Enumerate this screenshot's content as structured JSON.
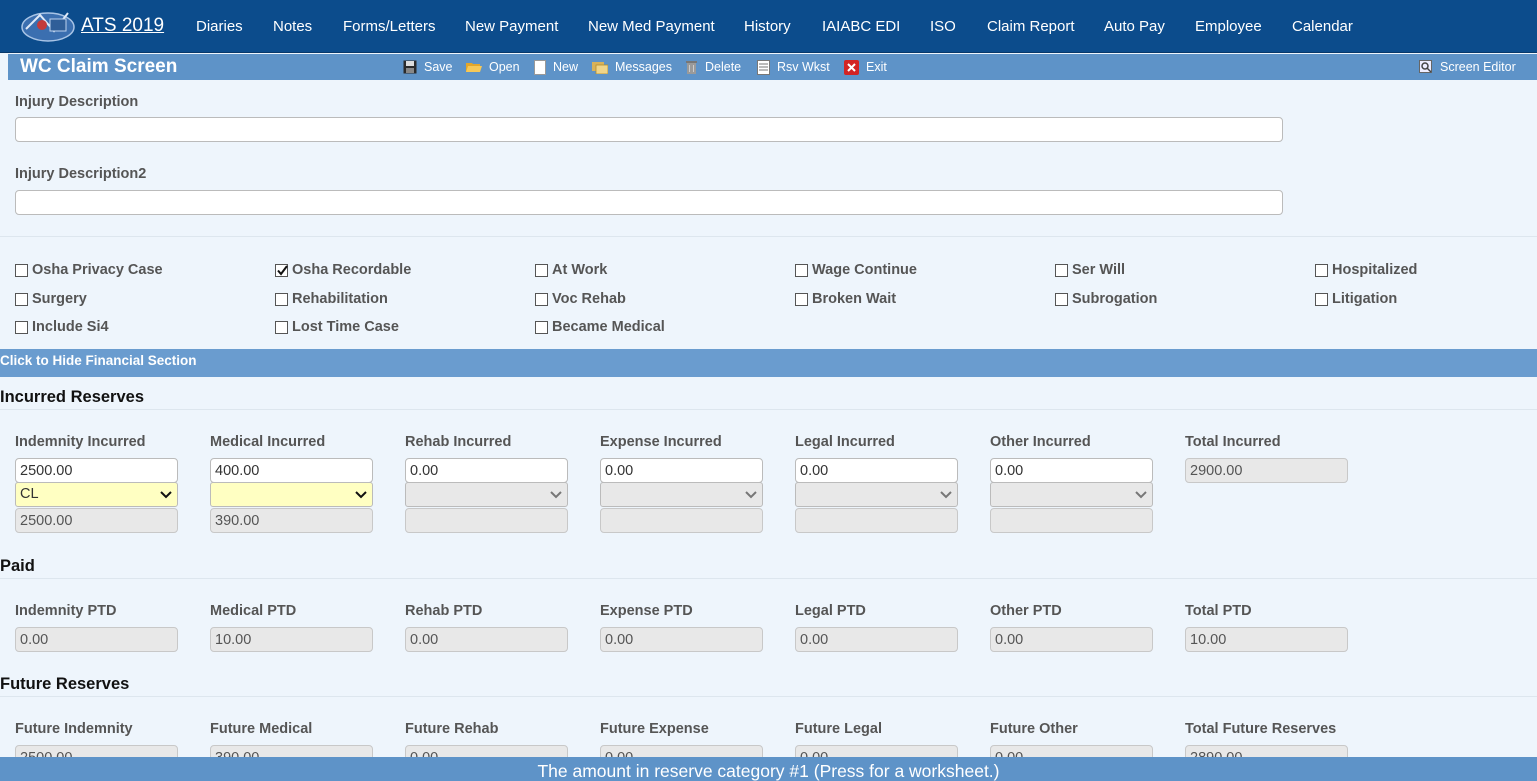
{
  "nav": {
    "app_title": "ATS 2019",
    "items": [
      "Diaries",
      "Notes",
      "Forms/Letters",
      "New Payment",
      "New Med Payment",
      "History",
      "IAIABC EDI",
      "ISO",
      "Claim Report",
      "Auto Pay",
      "Employee",
      "Calendar"
    ]
  },
  "toolbar": {
    "title": "WC Claim Screen",
    "save": "Save",
    "open": "Open",
    "new": "New",
    "messages": "Messages",
    "delete": "Delete",
    "rsv_wkst": "Rsv Wkst",
    "exit": "Exit",
    "screen_editor": "Screen Editor"
  },
  "injury": {
    "desc_label": "Injury Description",
    "desc_value": "",
    "desc2_label": "Injury Description2",
    "desc2_value": ""
  },
  "checkboxes": [
    {
      "label": "Osha Privacy Case",
      "checked": false
    },
    {
      "label": "Osha Recordable",
      "checked": true
    },
    {
      "label": "At Work",
      "checked": false
    },
    {
      "label": "Wage Continue",
      "checked": false
    },
    {
      "label": "Ser Will",
      "checked": false
    },
    {
      "label": "Hospitalized",
      "checked": false
    },
    {
      "label": "Surgery",
      "checked": false
    },
    {
      "label": "Rehabilitation",
      "checked": false
    },
    {
      "label": "Voc Rehab",
      "checked": false
    },
    {
      "label": "Broken Wait",
      "checked": false
    },
    {
      "label": "Subrogation",
      "checked": false
    },
    {
      "label": "Litigation",
      "checked": false
    },
    {
      "label": "Include Si4",
      "checked": false
    },
    {
      "label": "Lost Time Case",
      "checked": false
    },
    {
      "label": "Became Medical",
      "checked": false
    }
  ],
  "financial_toggle": "Click to Hide Financial Section",
  "incurred": {
    "heading": "Incurred Reserves",
    "columns": [
      {
        "label": "Indemnity Incurred",
        "value": "2500.00",
        "select": "CL",
        "sub": "2500.00"
      },
      {
        "label": "Medical Incurred",
        "value": "400.00",
        "select": "",
        "sub": "390.00"
      },
      {
        "label": "Rehab Incurred",
        "value": "0.00",
        "select": "",
        "sub": ""
      },
      {
        "label": "Expense Incurred",
        "value": "0.00",
        "select": "",
        "sub": ""
      },
      {
        "label": "Legal Incurred",
        "value": "0.00",
        "select": "",
        "sub": ""
      },
      {
        "label": "Other Incurred",
        "value": "0.00",
        "select": "",
        "sub": ""
      }
    ],
    "total_label": "Total Incurred",
    "total_value": "2900.00"
  },
  "paid": {
    "heading": "Paid",
    "columns": [
      {
        "label": "Indemnity PTD",
        "value": "0.00"
      },
      {
        "label": "Medical PTD",
        "value": "10.00"
      },
      {
        "label": "Rehab PTD",
        "value": "0.00"
      },
      {
        "label": "Expense PTD",
        "value": "0.00"
      },
      {
        "label": "Legal PTD",
        "value": "0.00"
      },
      {
        "label": "Other PTD",
        "value": "0.00"
      },
      {
        "label": "Total PTD",
        "value": "10.00"
      }
    ]
  },
  "future": {
    "heading": "Future Reserves",
    "columns": [
      {
        "label": "Future Indemnity",
        "value": "2500.00"
      },
      {
        "label": "Future Medical",
        "value": "390.00"
      },
      {
        "label": "Future Rehab",
        "value": "0.00"
      },
      {
        "label": "Future Expense",
        "value": "0.00"
      },
      {
        "label": "Future Legal",
        "value": "0.00"
      },
      {
        "label": "Future Other",
        "value": "0.00"
      },
      {
        "label": "Total Future Reserves",
        "value": "2890.00"
      }
    ]
  },
  "status_message": "The amount in reserve category #1 (Press for a worksheet.)"
}
